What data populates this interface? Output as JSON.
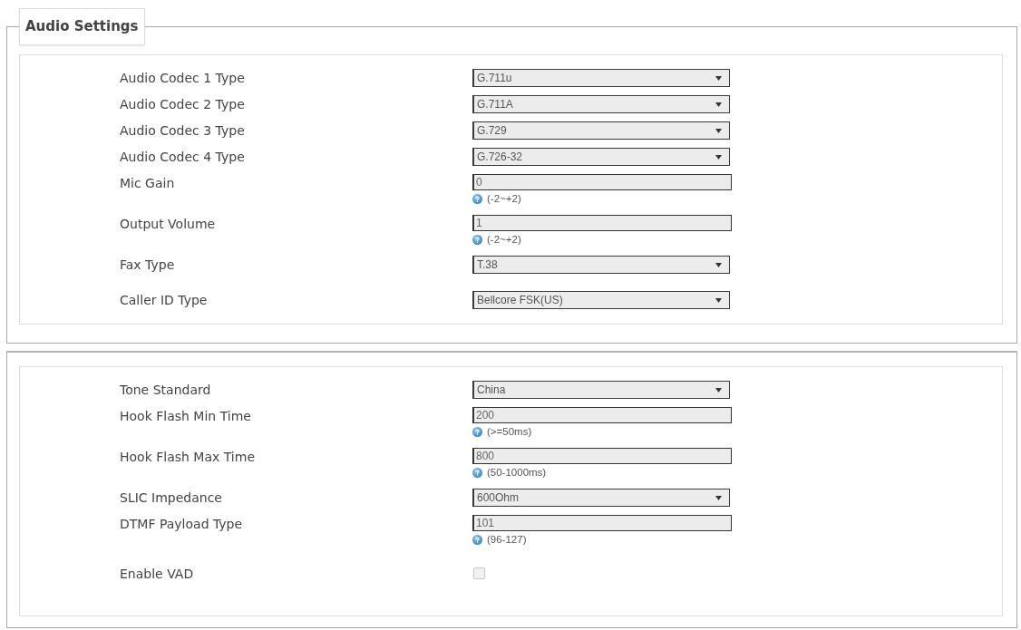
{
  "sections": [
    {
      "legend": "Audio Settings",
      "rows": [
        {
          "kind": "select",
          "label": "Audio Codec 1 Type",
          "value": "G.711u"
        },
        {
          "kind": "select",
          "label": "Audio Codec 2 Type",
          "value": "G.711A"
        },
        {
          "kind": "select",
          "label": "Audio Codec 3 Type",
          "value": "G.729"
        },
        {
          "kind": "select",
          "label": "Audio Codec 4 Type",
          "value": "G.726-32"
        },
        {
          "kind": "input",
          "label": "Mic Gain",
          "value": "0",
          "hint": "(-2~+2)"
        },
        {
          "kind": "input",
          "label": "Output Volume",
          "value": "1",
          "hint": "(-2~+2)"
        },
        {
          "kind": "select",
          "label": "Fax Type",
          "value": "T.38"
        },
        {
          "kind": "select",
          "label": "Caller ID Type",
          "value": "Bellcore FSK(US)"
        }
      ]
    },
    {
      "rows": [
        {
          "kind": "select",
          "label": "Tone Standard",
          "value": "China"
        },
        {
          "kind": "input",
          "label": "Hook Flash Min Time",
          "value": "200",
          "hint": "(>=50ms)"
        },
        {
          "kind": "input",
          "label": "Hook Flash Max Time",
          "value": "800",
          "hint": "(50-1000ms)"
        },
        {
          "kind": "select",
          "label": "SLIC Impedance",
          "value": "600Ohm"
        },
        {
          "kind": "input",
          "label": "DTMF Payload Type",
          "value": "101",
          "hint": "(96-127)"
        },
        {
          "kind": "checkbox",
          "label": "Enable VAD",
          "checked": false
        }
      ]
    }
  ]
}
